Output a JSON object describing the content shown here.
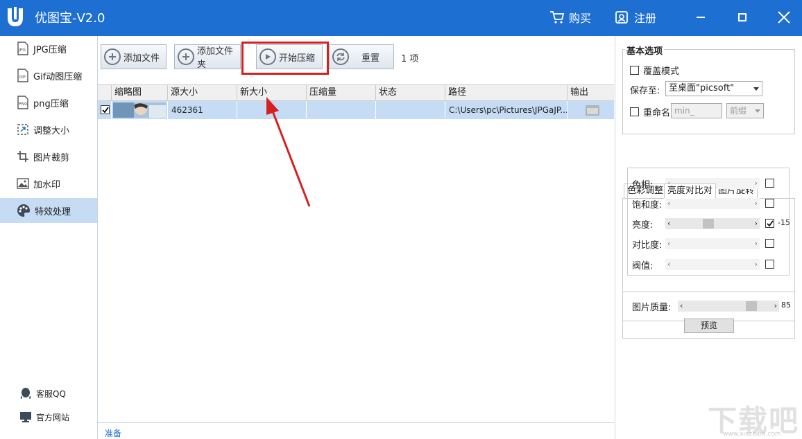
{
  "app": {
    "title": "优图宝-V2.0",
    "buy_label": "购买",
    "register_label": "注册"
  },
  "sidebar": {
    "items": [
      {
        "label": "JPG压缩"
      },
      {
        "label": "Gif动图压缩"
      },
      {
        "label": "png压缩"
      },
      {
        "label": "调整大小"
      },
      {
        "label": "图片裁剪"
      },
      {
        "label": "加水印"
      },
      {
        "label": "特效处理"
      }
    ],
    "bottom": [
      {
        "label": "客服QQ"
      },
      {
        "label": "官方网站"
      }
    ]
  },
  "toolbar": {
    "add_file": "添加文件",
    "add_folder": "添加文件夹",
    "start": "开始压缩",
    "reset": "重置",
    "count": "1 项"
  },
  "table": {
    "headers": [
      "缩略图",
      "源大小",
      "新大小",
      "压缩量",
      "状态",
      "路径",
      "输出"
    ],
    "rows": [
      {
        "checked": true,
        "source_size": "462361",
        "new_size": "",
        "saving": "",
        "status": "",
        "path": "C:\\Users\\pc\\Pictures\\JPGaJP..."
      }
    ]
  },
  "status_bar": "准备",
  "right": {
    "basic_title": "基本选项",
    "overwrite_label": "覆盖模式",
    "save_to_label": "保存至:",
    "save_to_value": "至桌面\"picsoft\"",
    "rename_label": "重命名",
    "rename_placeholder": "min_",
    "prefix_value": "前缀",
    "tabs": [
      "色彩调整",
      "亮度对比对",
      "图片旋转"
    ],
    "sliders": [
      {
        "label": "色相:",
        "enabled": false,
        "checked": false,
        "value": null
      },
      {
        "label": "饱和度:",
        "enabled": false,
        "checked": false,
        "value": null
      },
      {
        "label": "亮度:",
        "enabled": true,
        "checked": true,
        "value": "-15"
      },
      {
        "label": "对比度:",
        "enabled": false,
        "checked": false,
        "value": null
      },
      {
        "label": "阀值:",
        "enabled": false,
        "checked": false,
        "value": null
      }
    ],
    "quality_label": "图片质量:",
    "quality_value": "85",
    "preview_button": "预览"
  },
  "watermark": {
    "text": "下载吧",
    "url": "www.xiazaiba.com"
  },
  "colors": {
    "title_bar": "#1e6fd2",
    "selection": "#c5dcf4",
    "highlight": "#d62020"
  }
}
